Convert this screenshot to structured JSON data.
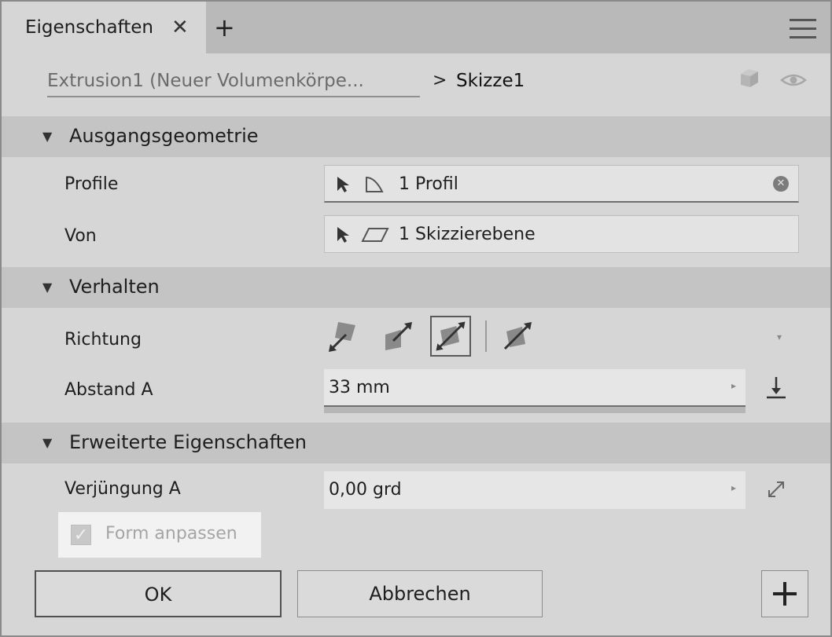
{
  "tab": {
    "label": "Eigenschaften",
    "close_glyph": "✕",
    "add_glyph": "+"
  },
  "breadcrumb": {
    "parent": "Extrusion1 (Neuer Volumenkörpe...",
    "separator": ">",
    "current": "Skizze1"
  },
  "sections": {
    "geometry": {
      "title": "Ausgangsgeometrie"
    },
    "behavior": {
      "title": "Verhalten"
    },
    "advanced": {
      "title": "Erweiterte Eigenschaften"
    }
  },
  "fields": {
    "profile": {
      "label": "Profile",
      "value": "1 Profil"
    },
    "from": {
      "label": "Von",
      "value": "1 Skizzierebene"
    },
    "direction": {
      "label": "Richtung"
    },
    "distance": {
      "label": "Abstand A",
      "value": "33 mm"
    },
    "taper": {
      "label": "Verjüngung A",
      "value": "0,00 grd"
    }
  },
  "checkbox": {
    "label": "Form anpassen",
    "checked": true
  },
  "buttons": {
    "ok": "OK",
    "cancel": "Abbrechen"
  },
  "icons": {
    "triangle": "▼",
    "check": "✓",
    "spin": "▸",
    "dropdown": "▾"
  },
  "colors": {
    "panel": "#d6d6d6",
    "section": "#c4c4c4",
    "field": "#e3e3e3"
  }
}
